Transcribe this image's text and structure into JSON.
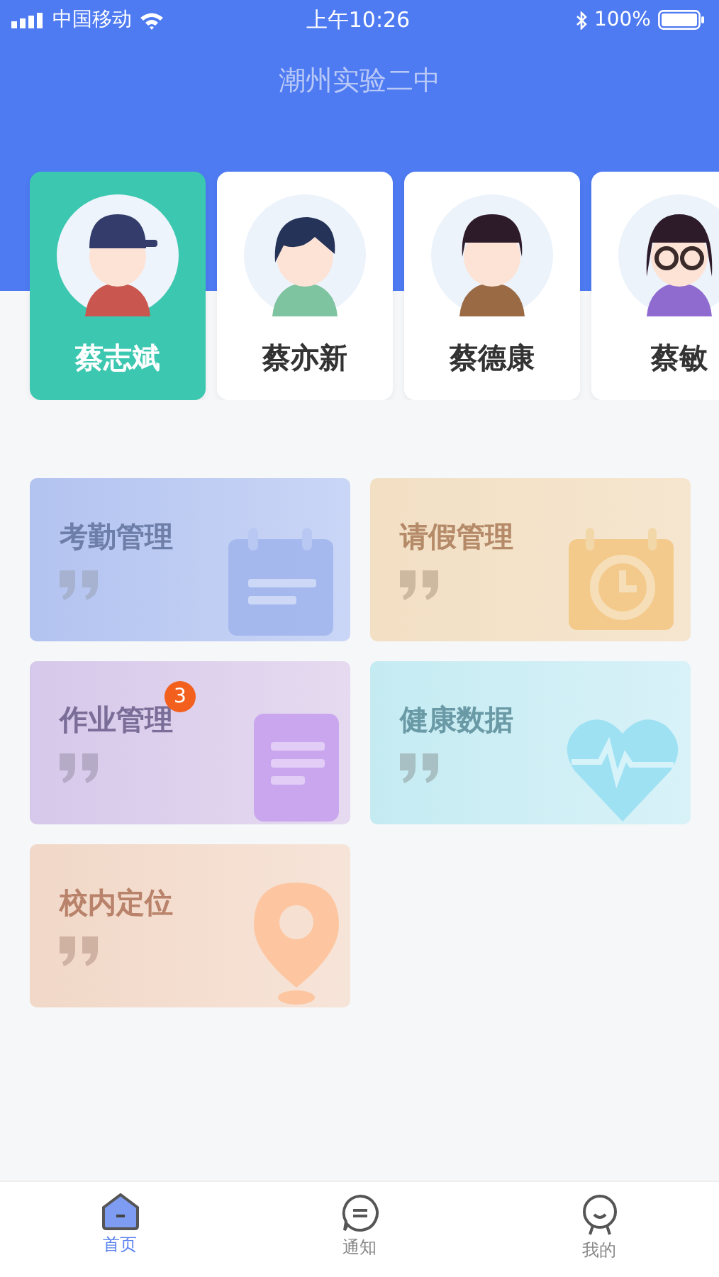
{
  "status_bar": {
    "carrier": "中国移动",
    "time": "上午10:26",
    "battery": "100%"
  },
  "header": {
    "title": "潮州实验二中"
  },
  "students": [
    {
      "name": "蔡志斌",
      "selected": true,
      "kind": "cap"
    },
    {
      "name": "蔡亦新",
      "selected": false,
      "kind": "side"
    },
    {
      "name": "蔡德康",
      "selected": false,
      "kind": "bowl"
    },
    {
      "name": "蔡敏",
      "selected": false,
      "kind": "glasses"
    }
  ],
  "menu": [
    {
      "label": "考勤管理",
      "kind": "attendance"
    },
    {
      "label": "请假管理",
      "kind": "leave"
    },
    {
      "label": "作业管理",
      "kind": "homework",
      "badge": "3"
    },
    {
      "label": "健康数据",
      "kind": "health"
    },
    {
      "label": "校内定位",
      "kind": "location"
    }
  ],
  "tabs": [
    {
      "label": "首页",
      "selected": true,
      "kind": "home"
    },
    {
      "label": "通知",
      "selected": false,
      "kind": "notice"
    },
    {
      "label": "我的",
      "selected": false,
      "kind": "mine"
    }
  ]
}
